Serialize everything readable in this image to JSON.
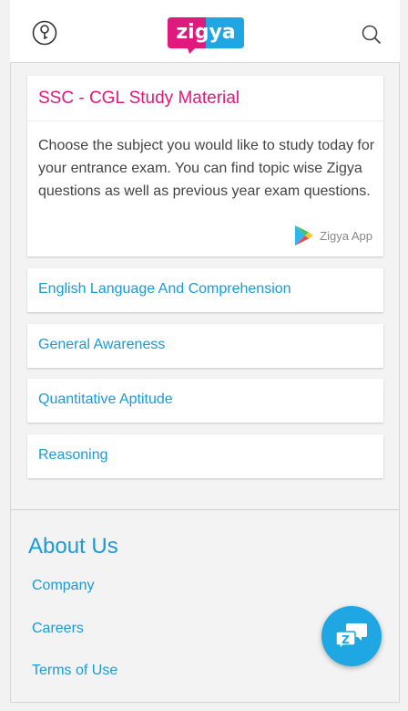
{
  "header": {
    "brand": "zigya",
    "icons": [
      "key-icon",
      "search-icon"
    ],
    "brand_colors": {
      "pink": "#e0197d",
      "blue": "#1ea7e2"
    }
  },
  "intro_card": {
    "title": "SSC - CGL Study Material",
    "description": "Choose the subject you would like to study today for your entrance exam. You can find topic wise Zigya questions as well as previous year exam questions.",
    "app_label": "Zigya App"
  },
  "subjects": [
    {
      "label": "English Language And Comprehension"
    },
    {
      "label": "General Awareness"
    },
    {
      "label": "Quantitative Aptitude"
    },
    {
      "label": "Reasoning"
    }
  ],
  "footer": {
    "heading": "About Us",
    "links": [
      "Company",
      "Careers",
      "Terms of Use"
    ]
  },
  "colors": {
    "accent": "#1c9ad6",
    "title": "#e0197d",
    "text": "#444444"
  }
}
